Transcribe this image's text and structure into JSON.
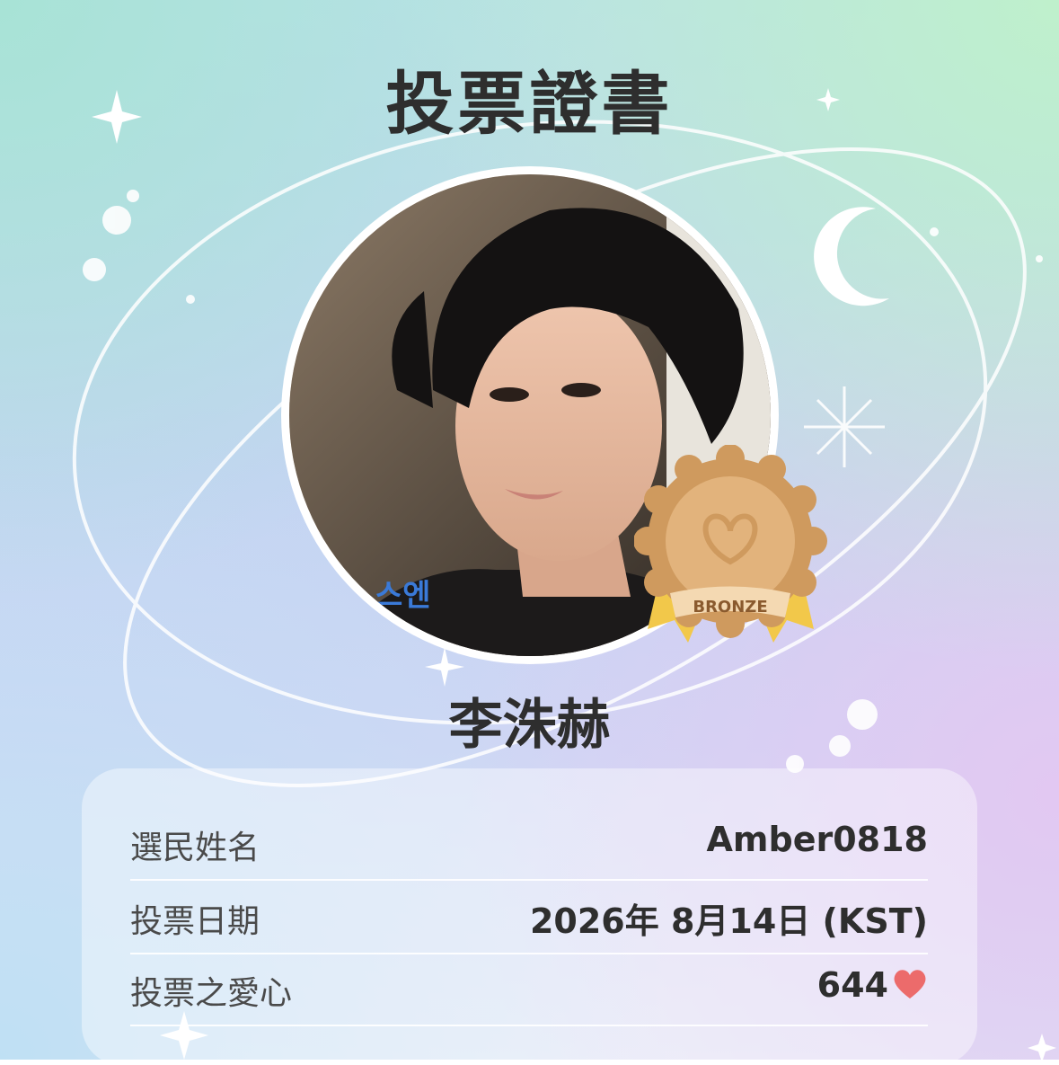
{
  "certificate": {
    "title": "投票證書",
    "star_name": "李洙赫",
    "badge_label": "BRONZE",
    "photo_caption": "스엔"
  },
  "details": [
    {
      "label": "選民姓名",
      "value": "Amber0818"
    },
    {
      "label": "投票日期",
      "value": "2026年 8月14日 (KST)"
    },
    {
      "label": "投票之愛心",
      "value": "644"
    }
  ],
  "icons": {
    "hearts": "heart-icon",
    "moon": "crescent-moon-icon",
    "sparkle": "sparkle-icon"
  },
  "colors": {
    "heart": "#ec6b6b",
    "bronze": "#cf9a5e",
    "ribbon": "#f2c84a",
    "title_text": "#2e2e2e"
  }
}
